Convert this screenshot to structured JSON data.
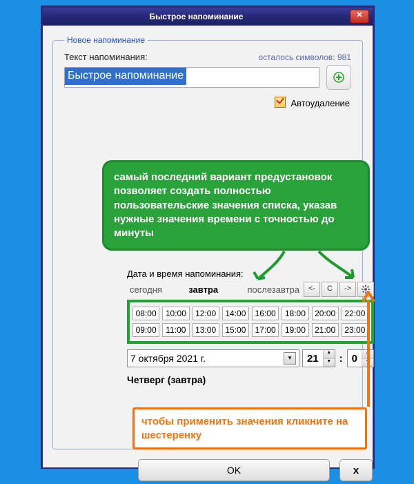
{
  "window": {
    "title": "Быстрое напоминание"
  },
  "group": {
    "legend": "Новое напоминание"
  },
  "text_label": "Текст напоминания:",
  "chars_prefix": "осталось символов: ",
  "chars_left": "981",
  "reminder_text": "Быстрое напоминание",
  "autodelete": "Автоудаление",
  "green_callout": "самый последний вариант предустановок позволяет создать полностью пользовательские значения списка, указав нужные значения времени с точностью до минуты",
  "dt_label": "Дата и время напоминания:",
  "days": {
    "today": "сегодня",
    "tomorrow": "завтра",
    "after": "послезавтра"
  },
  "nav": {
    "prev": "<-",
    "reset": "С",
    "next": "->"
  },
  "times": [
    "08:00",
    "10:00",
    "12:00",
    "14:00",
    "16:00",
    "18:00",
    "20:00",
    "22:00",
    "09:00",
    "11:00",
    "13:00",
    "15:00",
    "17:00",
    "19:00",
    "21:00",
    "23:00"
  ],
  "date_value": "7 октября 2021 г.",
  "hour": "21",
  "minute": "0",
  "colon": ":",
  "dow": "Четверг (завтра)",
  "orange_callout": "чтобы применить значения кликните на шестеренку",
  "buttons": {
    "ok": "OK",
    "cancel": "x"
  }
}
